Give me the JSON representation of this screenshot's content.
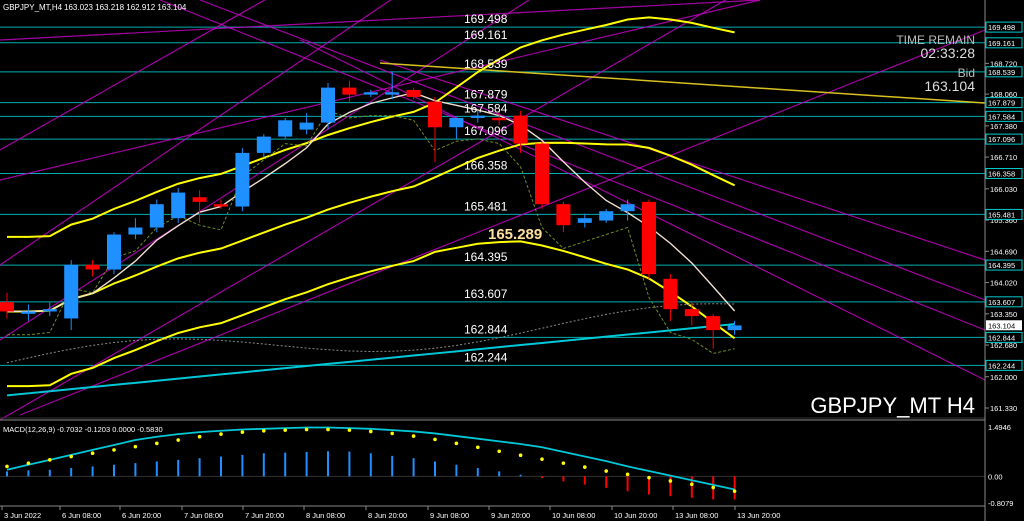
{
  "header": {
    "symbol_line": "GBPJPY_MT,H4",
    "ohlc": "163.023 163.218 162.912 163.104"
  },
  "info_panel": {
    "time_remain_label": "TIME REMAIN",
    "time_remain_value": "02:33:28",
    "bid_label": "Bid",
    "bid_value": "163.104"
  },
  "watermark": "GBPJPY_MT H4",
  "highlight_level": "165.289",
  "macd": {
    "label": "MACD(12,26,9) -0.7032 -0.1203 0.0000 -0.5830",
    "scale_labels": [
      "1.4946",
      "0.00",
      "-0.8079"
    ]
  },
  "price_axis": {
    "ticks": [
      "169.210",
      "168.720",
      "168.060",
      "167.380",
      "166.710",
      "166.030",
      "165.360",
      "164.690",
      "164.020",
      "163.350",
      "162.680",
      "162.000",
      "161.330"
    ],
    "current_price": "163.104",
    "level_badges": [
      "169.498",
      "169.161",
      "168.539",
      "167.879",
      "167.584",
      "167.096",
      "166.358",
      "165.481",
      "164.395",
      "163.607",
      "162.844",
      "162.244"
    ]
  },
  "horizontal_levels": [
    "169.498",
    "169.161",
    "168.539",
    "167.879",
    "167.584",
    "167.096",
    "166.358",
    "165.481",
    "164.395",
    "163.607",
    "162.844",
    "162.244"
  ],
  "time_axis": [
    "3 Jun 2022",
    "6 Jun 08:00",
    "6 Jun 20:00",
    "7 Jun 08:00",
    "7 Jun 20:00",
    "8 Jun 08:00",
    "8 Jun 20:00",
    "9 Jun 08:00",
    "9 Jun 20:00",
    "10 Jun 08:00",
    "10 Jun 20:00",
    "13 Jun 08:00",
    "13 Jun 20:00"
  ],
  "colors": {
    "background": "#000000",
    "bull_candle": "#1e90ff",
    "bear_candle": "#ff0000",
    "level_line": "#00cccc",
    "channel_line": "#cc00cc",
    "bollinger": "#ffff00",
    "ma_slow": "#00c8d8",
    "ma_fast": "#f0e0d0",
    "macd_signal": "#ffff00",
    "macd_line": "#00c8d8"
  },
  "chart_data": {
    "type": "candlestick",
    "timeframe": "H4",
    "ylim": [
      161.0,
      169.9
    ],
    "candles": [
      {
        "o": 163.6,
        "h": 163.8,
        "l": 163.25,
        "c": 163.4
      },
      {
        "o": 163.35,
        "h": 163.55,
        "l": 163.2,
        "c": 163.4
      },
      {
        "o": 163.4,
        "h": 163.6,
        "l": 163.3,
        "c": 163.45
      },
      {
        "o": 163.25,
        "h": 164.5,
        "l": 163.0,
        "c": 164.4
      },
      {
        "o": 164.4,
        "h": 164.5,
        "l": 164.15,
        "c": 164.3
      },
      {
        "o": 164.3,
        "h": 165.1,
        "l": 164.2,
        "c": 165.05
      },
      {
        "o": 165.05,
        "h": 165.4,
        "l": 164.95,
        "c": 165.2
      },
      {
        "o": 165.2,
        "h": 165.8,
        "l": 165.1,
        "c": 165.7
      },
      {
        "o": 165.4,
        "h": 166.05,
        "l": 165.3,
        "c": 165.95
      },
      {
        "o": 165.85,
        "h": 166.0,
        "l": 165.3,
        "c": 165.75
      },
      {
        "o": 165.7,
        "h": 165.8,
        "l": 165.6,
        "c": 165.65
      },
      {
        "o": 165.65,
        "h": 166.9,
        "l": 165.55,
        "c": 166.8
      },
      {
        "o": 166.8,
        "h": 167.2,
        "l": 166.7,
        "c": 167.15
      },
      {
        "o": 167.15,
        "h": 167.55,
        "l": 167.1,
        "c": 167.5
      },
      {
        "o": 167.3,
        "h": 167.65,
        "l": 167.2,
        "c": 167.45
      },
      {
        "o": 167.45,
        "h": 168.3,
        "l": 167.3,
        "c": 168.2
      },
      {
        "o": 168.2,
        "h": 168.35,
        "l": 167.9,
        "c": 168.05
      },
      {
        "o": 168.05,
        "h": 168.15,
        "l": 168.0,
        "c": 168.1
      },
      {
        "o": 168.05,
        "h": 168.55,
        "l": 167.95,
        "c": 168.1
      },
      {
        "o": 168.15,
        "h": 168.2,
        "l": 167.95,
        "c": 168.0
      },
      {
        "o": 167.9,
        "h": 168.0,
        "l": 166.6,
        "c": 167.35
      },
      {
        "o": 167.35,
        "h": 167.55,
        "l": 167.1,
        "c": 167.55
      },
      {
        "o": 167.55,
        "h": 167.7,
        "l": 167.45,
        "c": 167.6
      },
      {
        "o": 167.55,
        "h": 167.7,
        "l": 167.4,
        "c": 167.5
      },
      {
        "o": 167.6,
        "h": 167.7,
        "l": 166.8,
        "c": 167.0
      },
      {
        "o": 167.0,
        "h": 167.05,
        "l": 165.6,
        "c": 165.7
      },
      {
        "o": 165.7,
        "h": 165.75,
        "l": 165.1,
        "c": 165.25
      },
      {
        "o": 165.3,
        "h": 165.5,
        "l": 165.2,
        "c": 165.4
      },
      {
        "o": 165.35,
        "h": 165.6,
        "l": 165.3,
        "c": 165.55
      },
      {
        "o": 165.55,
        "h": 165.8,
        "l": 165.35,
        "c": 165.7
      },
      {
        "o": 165.75,
        "h": 165.8,
        "l": 164.1,
        "c": 164.2
      },
      {
        "o": 164.1,
        "h": 164.2,
        "l": 163.2,
        "c": 163.45
      },
      {
        "o": 163.45,
        "h": 163.6,
        "l": 163.1,
        "c": 163.3
      },
      {
        "o": 163.3,
        "h": 163.35,
        "l": 162.6,
        "c": 163.0
      },
      {
        "o": 163.0,
        "h": 163.2,
        "l": 162.9,
        "c": 163.1
      }
    ],
    "macd_histogram": [
      0.15,
      0.18,
      0.2,
      0.25,
      0.3,
      0.35,
      0.4,
      0.45,
      0.5,
      0.55,
      0.6,
      0.65,
      0.7,
      0.72,
      0.74,
      0.76,
      0.75,
      0.7,
      0.62,
      0.55,
      0.45,
      0.35,
      0.25,
      0.15,
      0.05,
      -0.05,
      -0.15,
      -0.25,
      -0.35,
      -0.45,
      -0.55,
      -0.6,
      -0.65,
      -0.7,
      -0.7
    ],
    "macd_signal": [
      0.3,
      0.4,
      0.5,
      0.6,
      0.7,
      0.8,
      0.9,
      1.0,
      1.1,
      1.2,
      1.28,
      1.34,
      1.38,
      1.4,
      1.42,
      1.42,
      1.4,
      1.36,
      1.3,
      1.22,
      1.12,
      1.0,
      0.88,
      0.76,
      0.64,
      0.52,
      0.4,
      0.28,
      0.16,
      0.06,
      -0.04,
      -0.14,
      -0.24,
      -0.34,
      -0.45
    ],
    "macd_line": [
      0.2,
      0.35,
      0.5,
      0.65,
      0.8,
      0.95,
      1.1,
      1.2,
      1.28,
      1.34,
      1.38,
      1.42,
      1.44,
      1.46,
      1.48,
      1.48,
      1.46,
      1.44,
      1.4,
      1.36,
      1.3,
      1.22,
      1.14,
      1.06,
      0.98,
      0.88,
      0.74,
      0.6,
      0.46,
      0.3,
      0.16,
      0.02,
      -0.12,
      -0.26,
      -0.4
    ]
  }
}
